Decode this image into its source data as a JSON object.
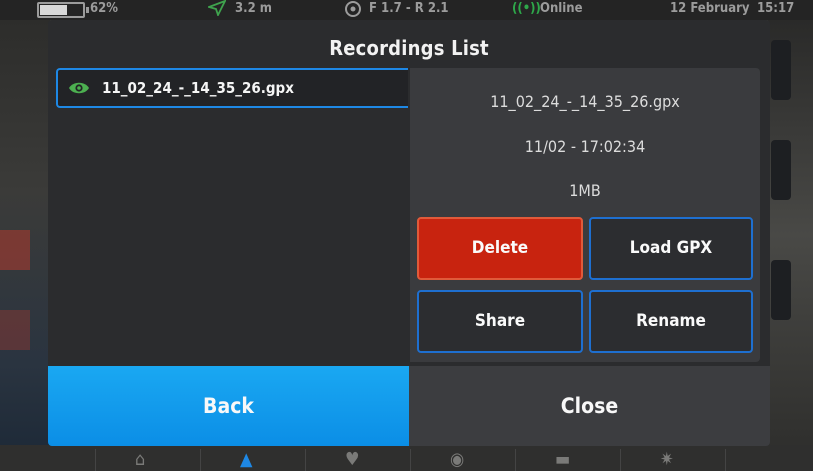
{
  "status_bar": {
    "battery": "62%",
    "battery_level": 0.62,
    "gps_accuracy": "3.2 m",
    "gear": "F 1.7 - R 2.1",
    "connection": "Online",
    "date": "12 February",
    "time": "15:17"
  },
  "dialog": {
    "title": "Recordings List",
    "recordings": [
      {
        "name": "11_02_24_-_14_35_26.gpx",
        "visible": true
      }
    ],
    "detail": {
      "file_name": "11_02_24_-_14_35_26.gpx",
      "timestamp": "11/02 - 17:02:34",
      "size": "1MB"
    },
    "actions": {
      "delete": "Delete",
      "load_gpx": "Load GPX",
      "share": "Share",
      "rename": "Rename"
    },
    "footer": {
      "back": "Back",
      "close": "Close"
    }
  },
  "colors": {
    "accent_blue": "#0b8ee6",
    "delete_red": "#c8230f",
    "online_green": "#2ea84a",
    "eye_green": "#4caf50"
  },
  "icons": [
    "battery-icon",
    "navigation-arrow-icon",
    "gear-icon",
    "signal-icon",
    "eye-icon",
    "home-icon",
    "map-pin-icon",
    "heart-icon",
    "compass-icon",
    "briefcase-icon",
    "settings-icon"
  ]
}
